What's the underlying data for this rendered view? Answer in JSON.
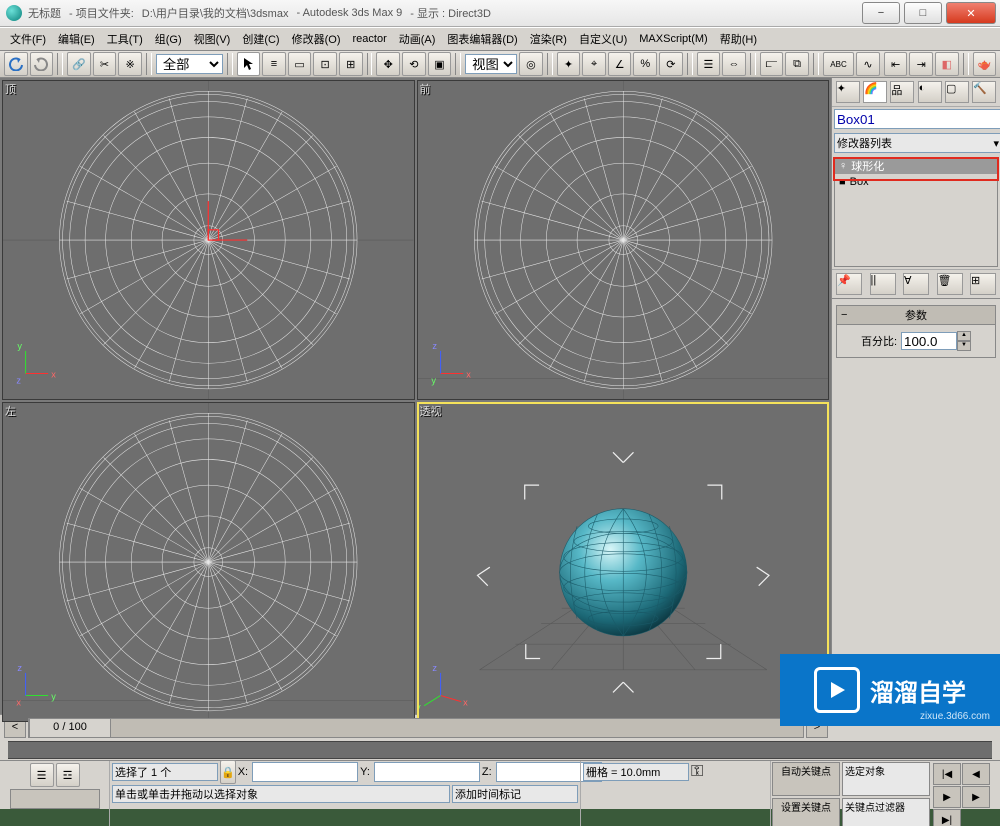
{
  "title": {
    "doc": "无标题",
    "proj_label": "- 项目文件夹:",
    "proj_path": "D:\\用户目录\\我的文档\\3dsmax",
    "app": "- Autodesk 3ds Max 9",
    "disp": "- 显示 : Direct3D"
  },
  "menu": [
    "文件(F)",
    "编辑(E)",
    "工具(T)",
    "组(G)",
    "视图(V)",
    "创建(C)",
    "修改器(O)",
    "reactor",
    "动画(A)",
    "图表编辑器(D)",
    "渲染(R)",
    "自定义(U)",
    "MAXScript(M)",
    "帮助(H)"
  ],
  "toolbar": {
    "selset": "全部",
    "refframe": "视图"
  },
  "viewports": {
    "top": "顶",
    "front": "前",
    "left": "左",
    "persp": "透视"
  },
  "panel": {
    "obj_name": "Box01",
    "mod_list_label": "修改器列表",
    "stack": [
      {
        "label": "球形化",
        "icon": "bulb",
        "sel": true
      },
      {
        "label": "Box",
        "icon": "cube",
        "sel": false
      }
    ],
    "rollout_title": "参数",
    "percent_label": "百分比:",
    "percent_value": "100.0"
  },
  "timeline": {
    "pos": "0 / 100"
  },
  "status": {
    "selected": "选择了 1 个",
    "x_label": "X:",
    "y_label": "Y:",
    "z_label": "Z:",
    "x": "",
    "y": "",
    "z": "",
    "grid": "栅格 = 10.0mm",
    "prompt": "单击或单击并拖动以选择对象",
    "timetag": "添加时间标记",
    "autokey": "自动关键点",
    "selobj": "选定对象",
    "setkey": "设置关键点",
    "keyfilter": "关键点过滤器"
  },
  "watermark": {
    "brand": "溜溜自学",
    "url": "zixue.3d66.com"
  }
}
